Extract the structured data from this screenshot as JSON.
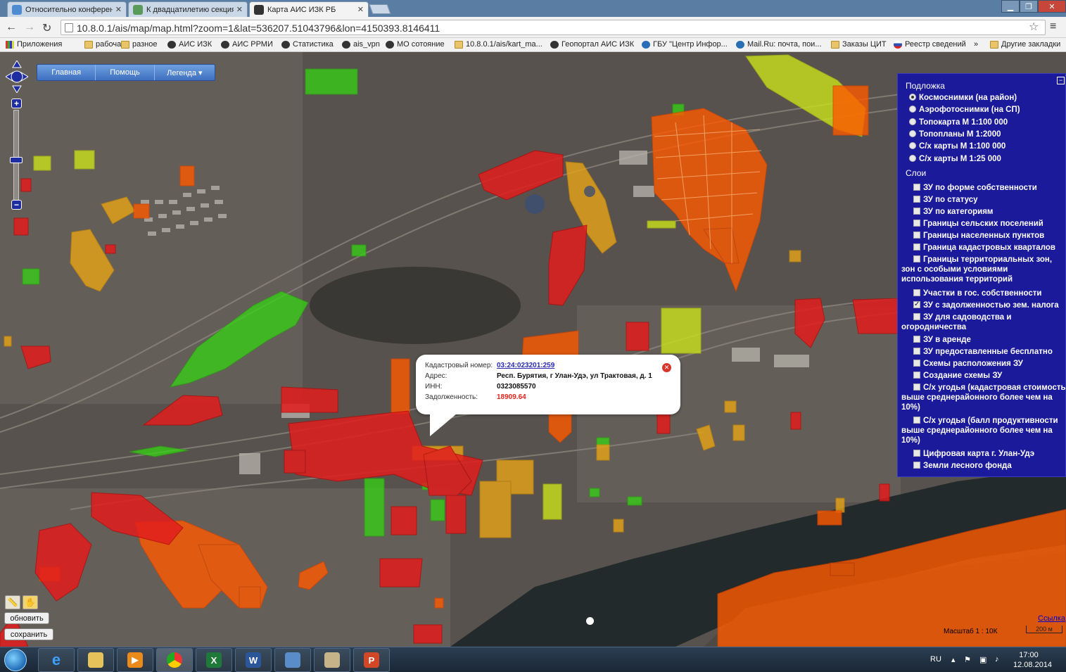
{
  "browser": {
    "tabs": [
      {
        "label": "Относительно конферен",
        "icon_color": "#4f8bd1",
        "active": false
      },
      {
        "label": "К двадцатилетию секция",
        "icon_color": "#5a9a5a",
        "active": false
      },
      {
        "label": "Карта АИС ИЗК РБ",
        "icon_color": "#333333",
        "active": true
      }
    ],
    "url": "10.8.0.1/ais/map/map.html?zoom=1&lat=536207.51043796&lon=4150393.8146411",
    "bookmarks": [
      {
        "label": "Приложения",
        "icon": "grid"
      },
      {
        "label": "рабочая",
        "icon": "folder"
      },
      {
        "label": "разное",
        "icon": "folder"
      },
      {
        "label": "АИС ИЗК",
        "icon": "dark"
      },
      {
        "label": "АИС РРМИ",
        "icon": "dark"
      },
      {
        "label": "Статистика",
        "icon": "dark"
      },
      {
        "label": "ais_vpn",
        "icon": "dark"
      },
      {
        "label": "МО сотояние",
        "icon": "dark"
      },
      {
        "label": "10.8.0.1/ais/kart_ma...",
        "icon": "folder"
      },
      {
        "label": "Геопортал АИС ИЗК",
        "icon": "dark"
      },
      {
        "label": "ГБУ \"Центр Инфор...",
        "icon": "globe"
      },
      {
        "label": "Mail.Ru: почта, пои...",
        "icon": "globe"
      },
      {
        "label": "Заказы ЦИТ",
        "icon": "folder"
      },
      {
        "label": "Реестр сведений",
        "icon": "flag"
      },
      {
        "label": "»",
        "icon": "none"
      },
      {
        "label": "Другие закладки",
        "icon": "folder"
      }
    ]
  },
  "map_menu": {
    "items": [
      "Главная",
      "Помощь",
      "Легенда ▾"
    ]
  },
  "layers_panel": {
    "base_header": "Подложка",
    "base_options": [
      {
        "label": "Космоснимки (на район)",
        "selected": true
      },
      {
        "label": "Аэрофотоснимки (на СП)",
        "selected": false
      },
      {
        "label": "Топокарта М 1:100 000",
        "selected": false
      },
      {
        "label": "Топопланы М 1:2000",
        "selected": false
      },
      {
        "label": "С/х карты М 1:100 000",
        "selected": false
      },
      {
        "label": "С/х карты М 1:25 000",
        "selected": false
      }
    ],
    "layers_header": "Слои",
    "layers": [
      {
        "label": "ЗУ по форме собственности",
        "checked": false
      },
      {
        "label": "ЗУ по статусу",
        "checked": false
      },
      {
        "label": "ЗУ по категориям",
        "checked": false
      },
      {
        "label": "Границы сельских поселений",
        "checked": false
      },
      {
        "label": "Границы населенных пунктов",
        "checked": false
      },
      {
        "label": "Граница кадастровых кварталов",
        "checked": false
      },
      {
        "label": "Границы территориальных зон, зон с особыми условиями использования территорий",
        "checked": false
      },
      {
        "label": "Участки в гос. собственности",
        "checked": false
      },
      {
        "label": "ЗУ с задолженностью зем. налога",
        "checked": true
      },
      {
        "label": "ЗУ для садоводства и огородничества",
        "checked": false
      },
      {
        "label": "ЗУ в аренде",
        "checked": false
      },
      {
        "label": "ЗУ предоставленные бесплатно",
        "checked": false
      },
      {
        "label": "Схемы расположения ЗУ",
        "checked": false
      },
      {
        "label": "Создание схемы ЗУ",
        "checked": false
      },
      {
        "label": "С/х угодья (кадастровая стоимость выше среднерайонного более чем на 10%)",
        "checked": false
      },
      {
        "label": "С/х угодья (балл продуктивности выше среднерайонного более чем на 10%)",
        "checked": false
      },
      {
        "label": "Цифровая карта г. Улан-Удэ",
        "checked": false
      },
      {
        "label": "Земли лесного фонда",
        "checked": false
      }
    ]
  },
  "popup": {
    "cad_label": "Кадастровый номер:",
    "cad_value": "03:24:023201:259",
    "addr_label": "Адрес:",
    "addr_value": "Респ. Бурятия, г Улан-Удэ, ул Трактовая, д. 1",
    "inn_label": "ИНН:",
    "inn_value": "0323085570",
    "debt_label": "Задолженность:",
    "debt_value": "18909.64"
  },
  "map_buttons": {
    "refresh": "обновить",
    "save": "сохранить"
  },
  "scale": {
    "text": "Масштаб 1 : 10К",
    "bar": "200 м",
    "link": "Ссылка"
  },
  "taskbar": {
    "lang": "RU",
    "time": "17:00",
    "date": "12.08.2014"
  },
  "colors": {
    "debt_high": "#e21d1d",
    "debt_mid": "#ff5a00",
    "debt_low": "#e8a417",
    "debt_min": "#c9e21c",
    "paid": "#35d414",
    "panel": "#1a1a9a"
  }
}
